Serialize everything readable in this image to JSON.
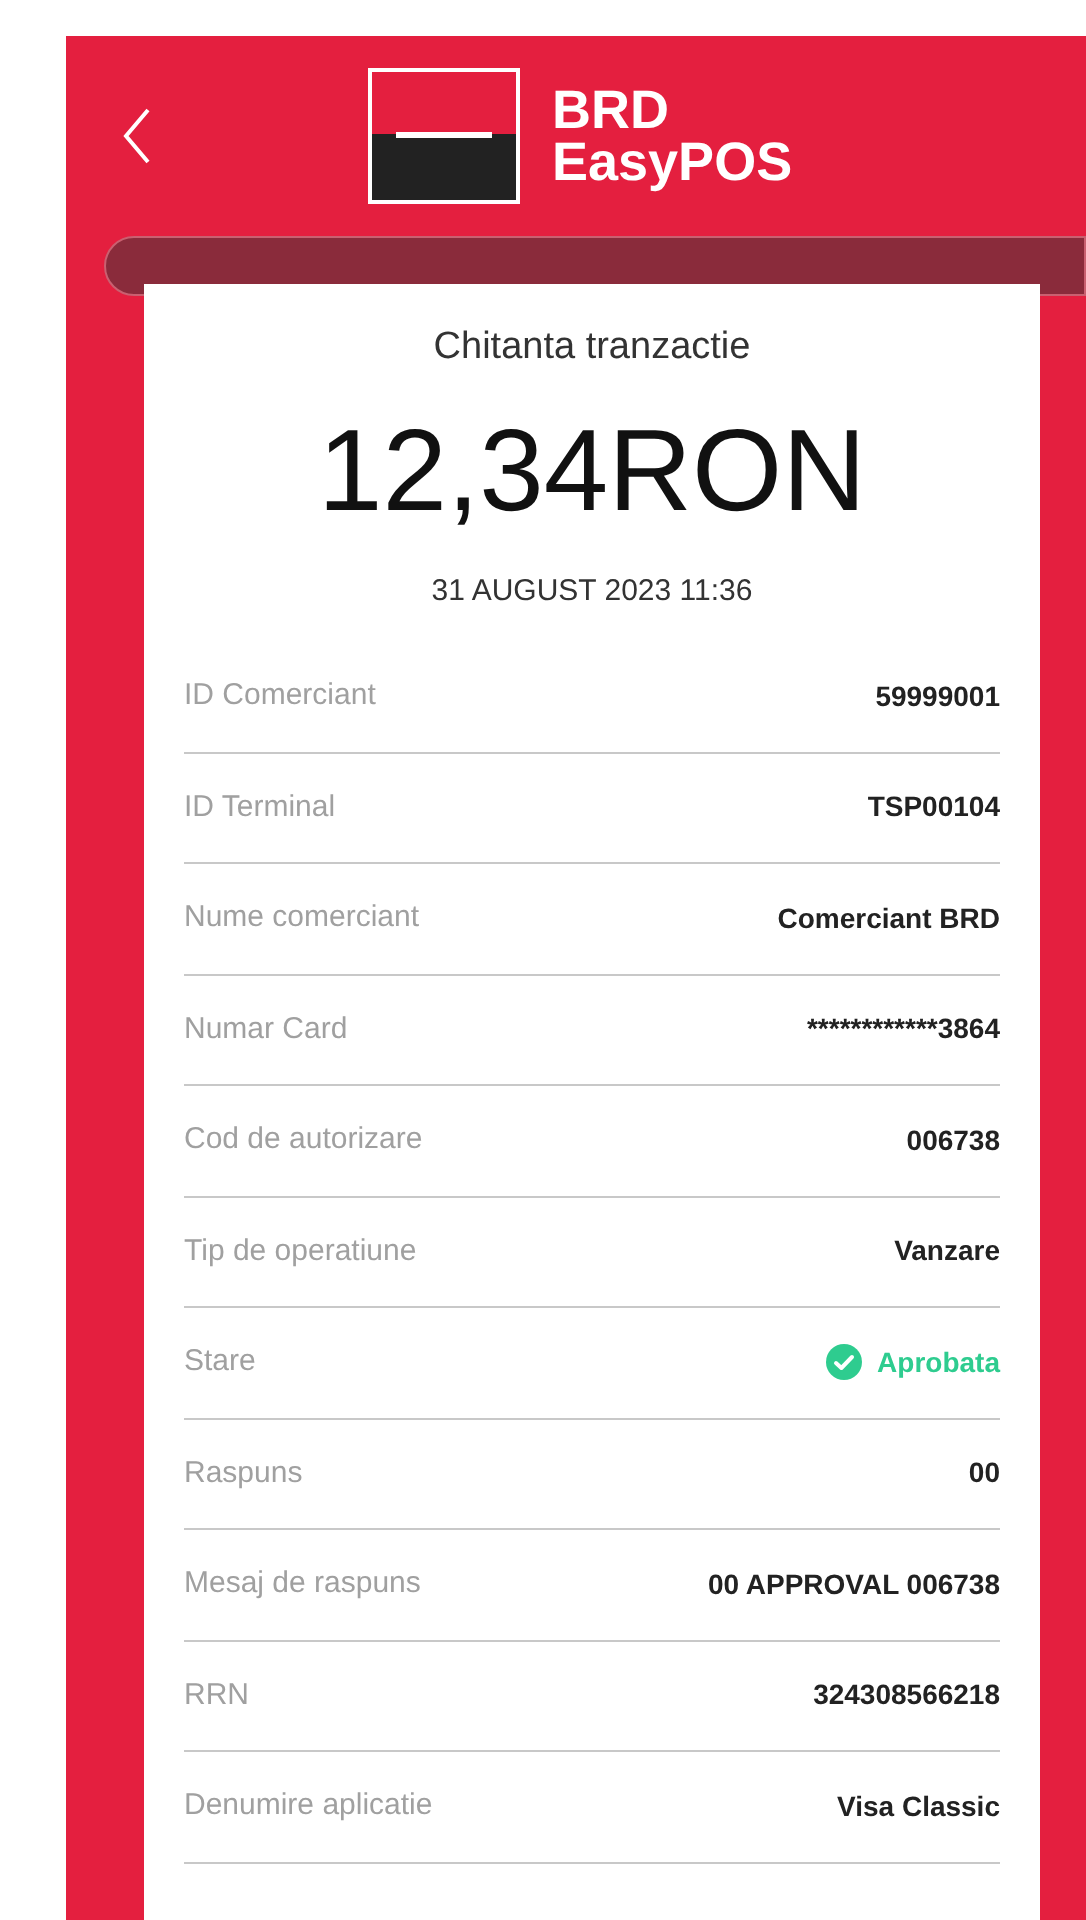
{
  "header": {
    "logo_line1": "BRD",
    "logo_line2": "EasyPOS"
  },
  "receipt": {
    "title": "Chitanta tranzactie",
    "amount": "12,34RON",
    "date": "31 AUGUST 2023 11:36",
    "rows": [
      {
        "kind": "text",
        "label": "ID Comerciant",
        "value": "59999001"
      },
      {
        "kind": "text",
        "label": "ID Terminal",
        "value": "TSP00104"
      },
      {
        "kind": "text",
        "label": "Nume comerciant",
        "value": "Comerciant BRD"
      },
      {
        "kind": "text",
        "label": "Numar Card",
        "value": "************3864"
      },
      {
        "kind": "text",
        "label": "Cod de autorizare",
        "value": "006738"
      },
      {
        "kind": "text",
        "label": "Tip de operatiune",
        "value": "Vanzare"
      },
      {
        "kind": "status",
        "label": "Stare",
        "value": "Aprobata",
        "color": "#2ecc8f"
      },
      {
        "kind": "text",
        "label": "Raspuns",
        "value": "00"
      },
      {
        "kind": "text",
        "label": "Mesaj de raspuns",
        "value": "00 APPROVAL 006738"
      },
      {
        "kind": "text",
        "label": "RRN",
        "value": "324308566218"
      },
      {
        "kind": "text",
        "label": "Denumire aplicatie",
        "value": "Visa Classic"
      }
    ]
  }
}
